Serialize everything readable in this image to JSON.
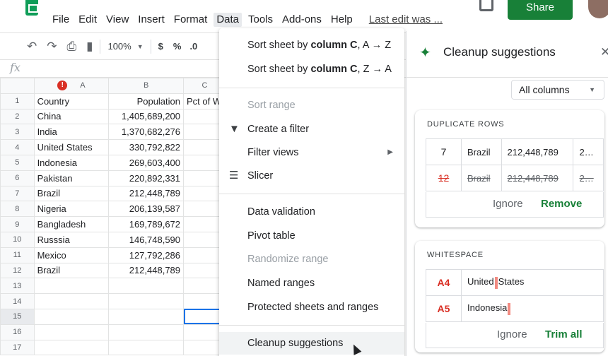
{
  "menubar": {
    "items": [
      "File",
      "Edit",
      "View",
      "Insert",
      "Format",
      "Data",
      "Tools",
      "Add-ons",
      "Help"
    ],
    "last_edit": "Last edit was ...",
    "share_label": "Share"
  },
  "toolbar": {
    "zoom": "100%",
    "currency": "$",
    "percent": "%",
    "decimals": ".0"
  },
  "formula": {
    "fx": "fx"
  },
  "sheet": {
    "columns": [
      "A",
      "B",
      "C"
    ],
    "col_c_partial": "Pct of W",
    "rows": [
      {
        "n": "1",
        "a": "Country",
        "b": "Population"
      },
      {
        "n": "2",
        "a": "China",
        "b": "1,405,689,200"
      },
      {
        "n": "3",
        "a": "India",
        "b": "1,370,682,276"
      },
      {
        "n": "4",
        "a": "United  States",
        "b": "330,792,822"
      },
      {
        "n": "5",
        "a": "Indonesia",
        "b": "269,603,400"
      },
      {
        "n": "6",
        "a": "Pakistan",
        "b": "220,892,331"
      },
      {
        "n": "7",
        "a": "Brazil",
        "b": "212,448,789"
      },
      {
        "n": "8",
        "a": "Nigeria",
        "b": "206,139,587"
      },
      {
        "n": "9",
        "a": "Bangladesh",
        "b": "169,789,672"
      },
      {
        "n": "10",
        "a": "Russsia",
        "b": "146,748,590"
      },
      {
        "n": "11",
        "a": "Mexico",
        "b": "127,792,286"
      },
      {
        "n": "12",
        "a": "Brazil",
        "b": "212,448,789"
      },
      {
        "n": "13",
        "a": "",
        "b": ""
      },
      {
        "n": "14",
        "a": "",
        "b": ""
      },
      {
        "n": "15",
        "a": "",
        "b": ""
      },
      {
        "n": "16",
        "a": "",
        "b": ""
      },
      {
        "n": "17",
        "a": "",
        "b": ""
      }
    ]
  },
  "data_menu": {
    "sort_az_pre": "Sort sheet by ",
    "sort_col": "column C",
    "sort_az_post": ", A → Z",
    "sort_za_post": ", Z → A",
    "sort_range": "Sort range",
    "create_filter": "Create a filter",
    "filter_views": "Filter views",
    "slicer": "Slicer",
    "data_validation": "Data validation",
    "pivot_table": "Pivot table",
    "randomize_range": "Randomize range",
    "named_ranges": "Named ranges",
    "protected": "Protected sheets and ranges",
    "cleanup": "Cleanup suggestions"
  },
  "sidebar": {
    "title": "Cleanup suggestions",
    "column_filter": "All columns",
    "duplicates": {
      "title": "DUPLICATE ROWS",
      "rows": [
        {
          "row": "7",
          "country": "Brazil",
          "pop": "212,448,789",
          "more": "2…"
        },
        {
          "row": "12",
          "country": "Brazil",
          "pop": "212,448,789",
          "more": "2…"
        }
      ],
      "ignore": "Ignore",
      "action": "Remove"
    },
    "whitespace": {
      "title": "WHITESPACE",
      "rows": [
        {
          "cell": "A4",
          "before": "United",
          "after": "States"
        },
        {
          "cell": "A5",
          "before": "Indonesia",
          "after": ""
        }
      ],
      "ignore": "Ignore",
      "action": "Trim all"
    }
  }
}
